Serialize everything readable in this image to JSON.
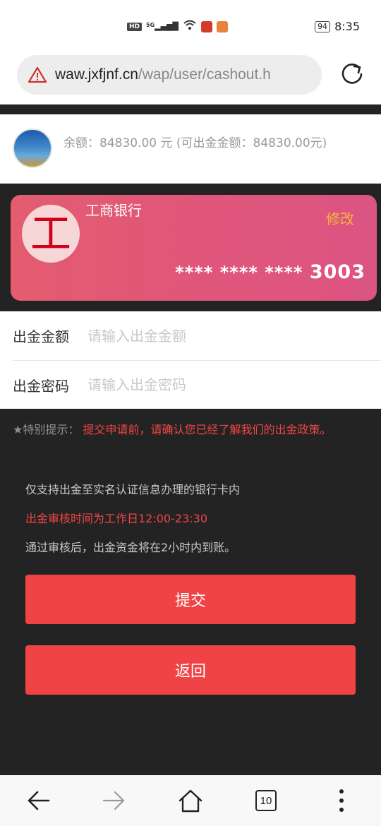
{
  "status_bar": {
    "hd": "HD",
    "network": "5G",
    "battery": "94",
    "time": "8:35"
  },
  "browser": {
    "url_host": "waw.jxfjnf.cn",
    "url_path": "/wap/user/cashout.h"
  },
  "account": {
    "balance_text": "余额：84830.00 元 (可出金金额：84830.00元)"
  },
  "card": {
    "logo_char": "工",
    "bank_name": "工商银行",
    "edit_label": "修改",
    "masked": "**** **** **** ",
    "last4": "3003"
  },
  "form": {
    "amount_label": "出金金额",
    "amount_placeholder": "请输入出金金额",
    "amount_value": "",
    "password_label": "出金密码",
    "password_placeholder": "请输入出金密码",
    "password_value": ""
  },
  "notice": {
    "prefix": "★特别提示：",
    "text": "提交申请前，请确认您已经了解我们的出金政策。"
  },
  "info": {
    "line1": "仅支持出金至实名认证信息办理的银行卡内",
    "line2": "出金审核时间为工作日12:00-23:30",
    "line3": "通过审核后，出金资金将在2小时内到账。"
  },
  "buttons": {
    "submit": "提交",
    "back": "返回"
  },
  "nav": {
    "tab_count": "10"
  },
  "colors": {
    "accent_red": "#ef4346",
    "notice_red": "#f04545",
    "card_pink": "#e0567b",
    "edit_gold": "#f5b73a",
    "page_dark": "#232323"
  },
  "icons": [
    "warning-icon",
    "reload-icon",
    "back-arrow-icon",
    "forward-arrow-icon",
    "home-icon",
    "tabs-icon",
    "more-menu-icon"
  ]
}
